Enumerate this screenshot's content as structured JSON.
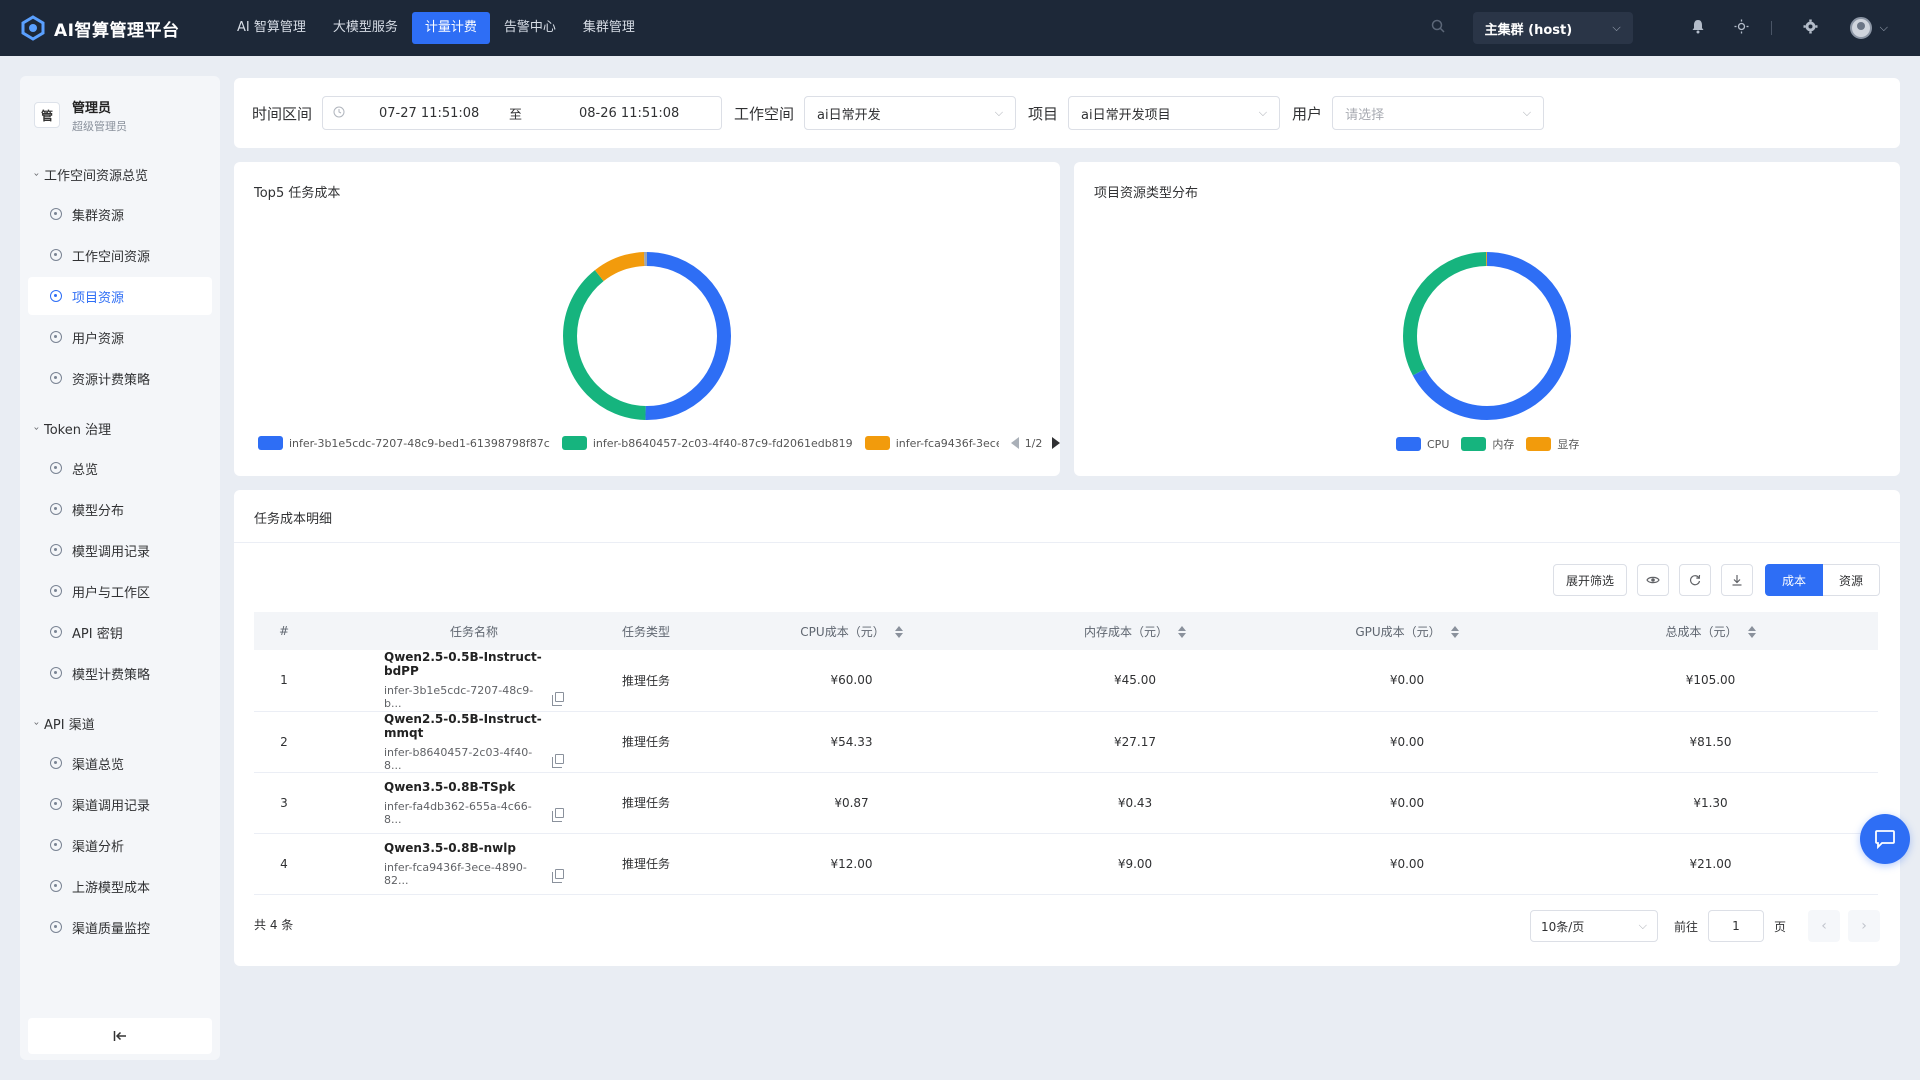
{
  "app": {
    "title": "AI智算管理平台"
  },
  "topnav": [
    {
      "label": "AI 智算管理",
      "active": false
    },
    {
      "label": "大模型服务",
      "active": false
    },
    {
      "label": "计量计费",
      "active": true
    },
    {
      "label": "告警中心",
      "active": false
    },
    {
      "label": "集群管理",
      "active": false
    }
  ],
  "header": {
    "cluster": "主集群 (host)"
  },
  "icons": {
    "search": "search-icon",
    "bell": "bell-icon",
    "theme": "sun-icon",
    "settings": "gear-icon",
    "user": "avatar-icon"
  },
  "sidebar": {
    "admin_badge": "管",
    "admin_name": "管理员",
    "admin_role": "超级管理员",
    "groups": [
      {
        "title": "工作空间资源总览",
        "items": [
          "集群资源",
          "工作空间资源",
          "项目资源",
          "用户资源",
          "资源计费策略"
        ]
      },
      {
        "title": "Token 治理",
        "items": [
          "总览",
          "模型分布",
          "模型调用记录",
          "用户与工作区",
          "API 密钥",
          "模型计费策略"
        ]
      },
      {
        "title": "API 渠道",
        "items": [
          "渠道总览",
          "渠道调用记录",
          "渠道分析",
          "上游模型成本",
          "渠道质量监控"
        ]
      }
    ],
    "active_item": "项目资源",
    "collapse_label": "|←"
  },
  "filters": {
    "time_label": "时间区间",
    "start": "07-27 11:51:08",
    "separator": "至",
    "end": "08-26 11:51:08",
    "workspace_label": "工作空间",
    "workspace_value": "ai日常开发",
    "project_label": "项目",
    "project_value": "ai日常开发项目",
    "user_label": "用户",
    "user_placeholder": "请选择"
  },
  "chart_top5": {
    "title": "Top5 任务成本",
    "legend": [
      "infer-3b1e5cdc-7207-48c9-bed1-61398798f87c",
      "infer-b8640457-2c03-4f40-87c9-fd2061edb819",
      "infer-fca9436f-3ece"
    ],
    "page": "1/2"
  },
  "chart_resource": {
    "title": "项目资源类型分布",
    "legend": [
      "CPU",
      "内存",
      "显存"
    ]
  },
  "chart_data": [
    {
      "type": "pie",
      "title": "Top5 任务成本",
      "labels": [
        "infer-3b1e5cdc-7207-48c9-bed1-61398798f87c",
        "infer-b8640457-2c03-4f40-87c9-fd2061edb819",
        "infer-fca9436f-3ece-4890-82",
        "infer-fa4db362-655a-4c66-8"
      ],
      "values": [
        105.0,
        81.5,
        21.0,
        1.3
      ],
      "colors": [
        "#2e6ef5",
        "#16b47e",
        "#f29b0c",
        "#9aa6b8"
      ]
    },
    {
      "type": "pie",
      "title": "项目资源类型分布",
      "labels": [
        "CPU",
        "内存",
        "显存"
      ],
      "values": [
        67.2,
        32.6,
        0.2
      ],
      "colors": [
        "#2e6ef5",
        "#16b47e",
        "#f29b0c"
      ]
    }
  ],
  "table": {
    "title": "任务成本明细",
    "toolbar": {
      "filter": "展开筛选",
      "cost": "成本",
      "resource": "资源"
    },
    "columns": [
      "#",
      "任务名称",
      "任务类型",
      "CPU成本（元）",
      "内存成本（元）",
      "GPU成本（元）",
      "总成本（元）"
    ],
    "rows": [
      {
        "idx": "1",
        "name": "Qwen2.5-0.5B-Instruct-bdPP",
        "id": "infer-3b1e5cdc-7207-48c9-b...",
        "type": "推理任务",
        "cpu": "¥60.00",
        "mem": "¥45.00",
        "gpu": "¥0.00",
        "total": "¥105.00"
      },
      {
        "idx": "2",
        "name": "Qwen2.5-0.5B-Instruct-mmqt",
        "id": "infer-b8640457-2c03-4f40-8...",
        "type": "推理任务",
        "cpu": "¥54.33",
        "mem": "¥27.17",
        "gpu": "¥0.00",
        "total": "¥81.50"
      },
      {
        "idx": "3",
        "name": "Qwen3.5-0.8B-TSpk",
        "id": "infer-fa4db362-655a-4c66-8...",
        "type": "推理任务",
        "cpu": "¥0.87",
        "mem": "¥0.43",
        "gpu": "¥0.00",
        "total": "¥1.30"
      },
      {
        "idx": "4",
        "name": "Qwen3.5-0.8B-nwlp",
        "id": "infer-fca9436f-3ece-4890-82...",
        "type": "推理任务",
        "cpu": "¥12.00",
        "mem": "¥9.00",
        "gpu": "¥0.00",
        "total": "¥21.00"
      }
    ],
    "total_text": "共 4 条",
    "page_size": "10条/页",
    "goto_label": "前往",
    "page_value": "1",
    "page_suffix": "页"
  }
}
